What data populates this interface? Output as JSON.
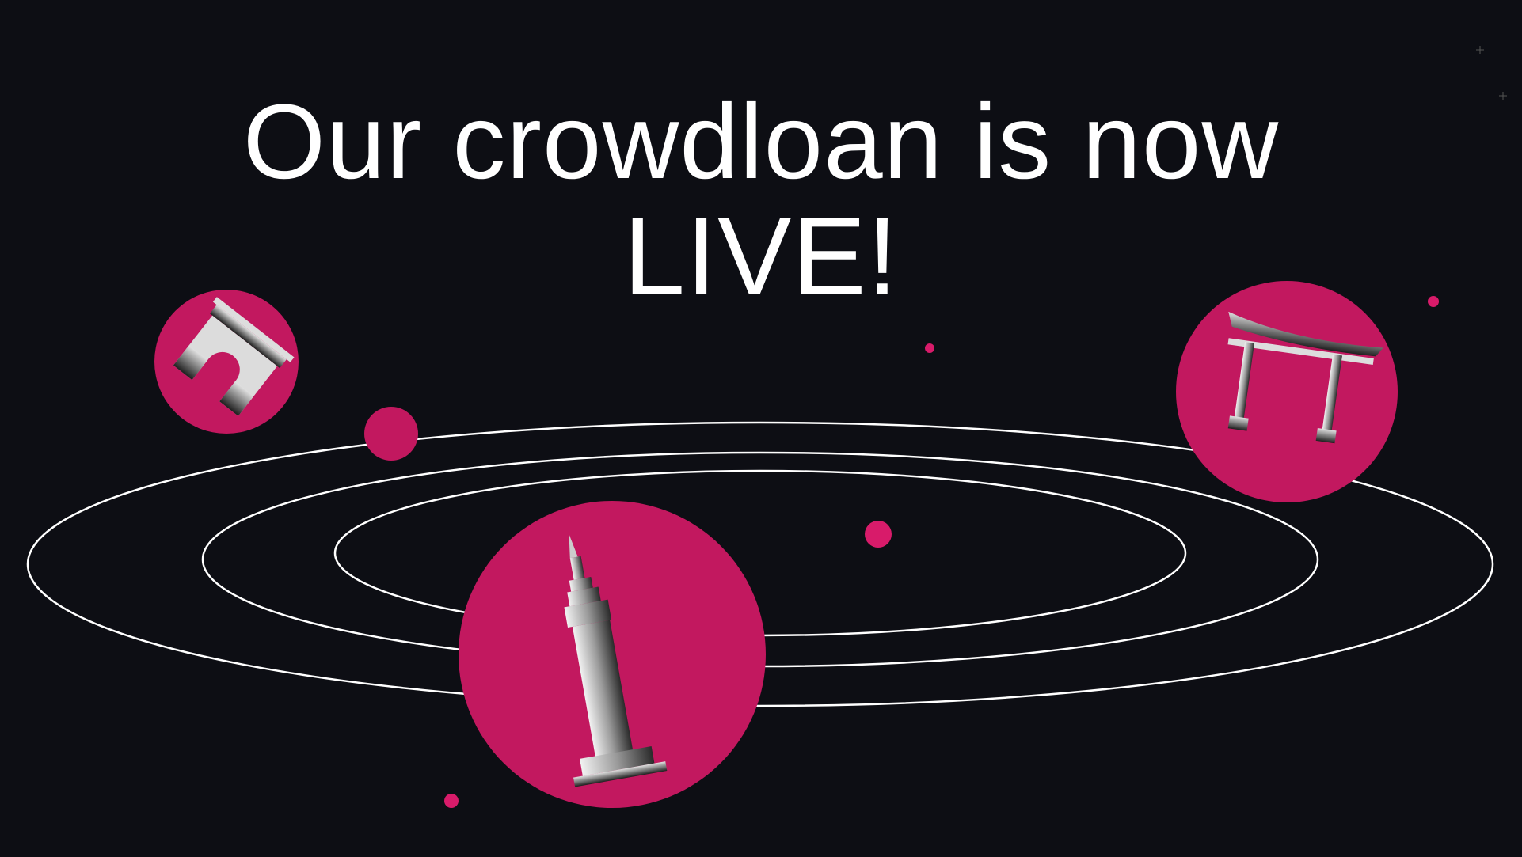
{
  "headline": {
    "line1": "Our crowdloan is now",
    "line2": "LIVE!"
  },
  "colors": {
    "background": "#0d0e14",
    "accent": "#c2185f",
    "accent_bright": "#d81b6a",
    "orbit": "#ffffff"
  },
  "icons": [
    "arch-icon",
    "torii-gate-icon",
    "skyscraper-icon"
  ]
}
